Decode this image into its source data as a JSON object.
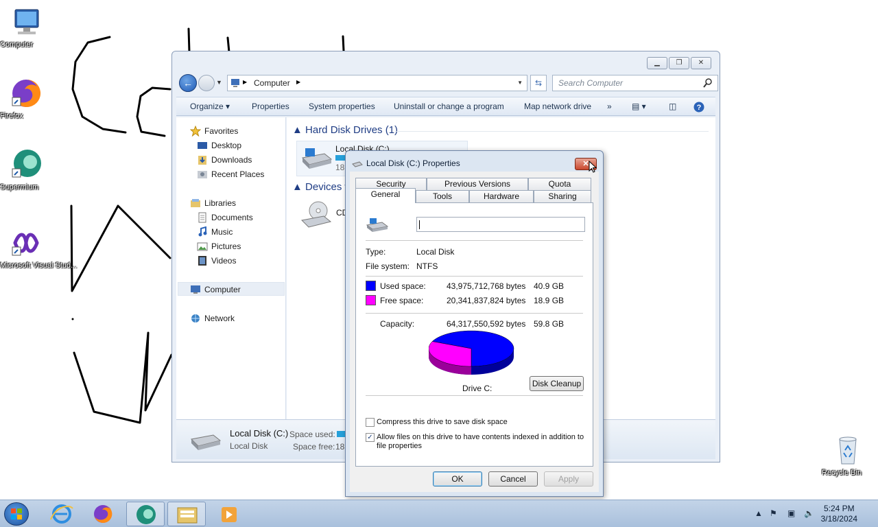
{
  "desktop": {
    "icons": [
      {
        "label": "Computer"
      },
      {
        "label": "Firefox"
      },
      {
        "label": "Supermium"
      },
      {
        "label": "Microsoft Visual Stud..."
      },
      {
        "label": "Recycle Bin"
      }
    ]
  },
  "explorer": {
    "address": "Computer",
    "search_placeholder": "Search Computer",
    "commands": [
      "Organize",
      "Properties",
      "System properties",
      "Uninstall or change a program",
      "Map network drive",
      "»"
    ],
    "nav": {
      "favorites": "Favorites",
      "desktop": "Desktop",
      "downloads": "Downloads",
      "recent": "Recent Places",
      "libraries": "Libraries",
      "documents": "Documents",
      "music": "Music",
      "pictures": "Pictures",
      "videos": "Videos",
      "computer": "Computer",
      "network": "Network"
    },
    "groups": {
      "hdd": "Hard Disk Drives (1)",
      "devices": "Devices w"
    },
    "tile": {
      "name": "Local Disk (C:)",
      "free_prefix": "18."
    },
    "cd_label": "CD",
    "details": {
      "name": "Local Disk (C:)",
      "type": "Local Disk",
      "space_used_label": "Space used:",
      "space_free_label": "Space free:",
      "free_prefix": "18."
    }
  },
  "dialog": {
    "title": "Local Disk (C:) Properties",
    "tabs_top": [
      "Security",
      "Previous Versions",
      "Quota"
    ],
    "tabs_bottom": [
      "General",
      "Tools",
      "Hardware",
      "Sharing"
    ],
    "type_label": "Type:",
    "type_value": "Local Disk",
    "fs_label": "File system:",
    "fs_value": "NTFS",
    "used_label": "Used space:",
    "used_bytes": "43,975,712,768 bytes",
    "used_gb": "40.9 GB",
    "free_label": "Free space:",
    "free_bytes": "20,341,837,824 bytes",
    "free_gb": "18.9 GB",
    "capacity_label": "Capacity:",
    "capacity_bytes": "64,317,550,592 bytes",
    "capacity_gb": "59.8 GB",
    "drive_label": "Drive C:",
    "disk_cleanup": "Disk Cleanup",
    "compress_label": "Compress this drive to save disk space",
    "compress_checked": false,
    "index_label_1": "Allow files on this drive to have contents indexed in addition to",
    "index_label_2": "file properties",
    "index_checked": true,
    "ok": "OK",
    "cancel": "Cancel",
    "apply": "Apply",
    "used_color": "#0000ff",
    "free_color": "#ff00ff",
    "used_fraction": 0.684
  },
  "taskbar": {
    "time": "5:24 PM",
    "date": "3/18/2024"
  }
}
